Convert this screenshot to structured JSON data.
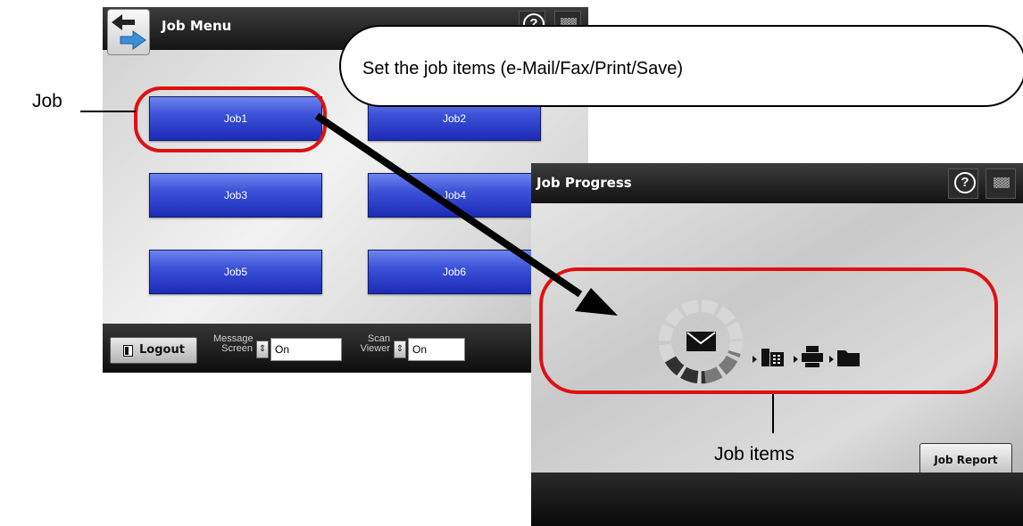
{
  "job_menu": {
    "title": "Job Menu",
    "help_icon": "?",
    "jobs": [
      "Job1",
      "Job2",
      "Job3",
      "Job4",
      "Job5",
      "Job6"
    ],
    "logout_label": "Logout",
    "message_screen": {
      "label_line1": "Message",
      "label_line2": "Screen",
      "value": "On"
    },
    "scan_viewer": {
      "label_line1": "Scan",
      "label_line2": "Viewer",
      "value": "On"
    }
  },
  "job_progress": {
    "title": "Job Progress",
    "help_icon": "?",
    "job_report_label": "Job Report",
    "job_item_icons": [
      "e-mail-icon",
      "fax-icon",
      "print-icon",
      "save-folder-icon"
    ]
  },
  "annotations": {
    "callout_text": "Set the job items (e-Mail/Fax/Print/Save)",
    "job_label": "Job",
    "job_items_label": "Job items",
    "accent_red": "#e01010"
  }
}
